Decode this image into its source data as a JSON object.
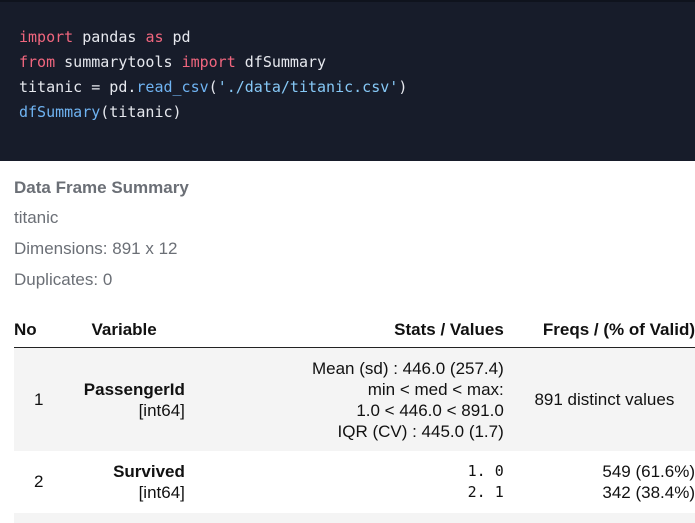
{
  "code": {
    "line1": {
      "kw1": "import",
      "mod": " pandas ",
      "kw2": "as",
      "alias": " pd"
    },
    "line2": {
      "kw1": "from",
      "mod": " summarytools ",
      "kw2": "import",
      "name": " dfSummary"
    },
    "line3": {
      "lhs": "titanic = pd.",
      "fn": "read_csv",
      "p1": "(",
      "str": "'./data/titanic.csv'",
      "p2": ")"
    },
    "line4": {
      "fn": "dfSummary",
      "args": "(titanic)"
    }
  },
  "summary": {
    "title": "Data Frame Summary",
    "name": "titanic",
    "dimensions": "Dimensions: 891 x 12",
    "duplicates": "Duplicates: 0"
  },
  "table": {
    "headers": {
      "no": "No",
      "variable": "Variable",
      "stats": "Stats / Values",
      "freqs": "Freqs / (% of Valid)"
    },
    "rows": [
      {
        "no": "1",
        "name": "PassengerId",
        "type": "[int64]",
        "stats": [
          "Mean (sd) : 446.0 (257.4)",
          "min < med < max:",
          "1.0 < 446.0 < 891.0",
          "IQR (CV) : 445.0 (1.7)"
        ],
        "freqs": [
          "891 distinct values"
        ]
      },
      {
        "no": "2",
        "name": "Survived",
        "type": "[int64]",
        "stats": [
          "1. 0",
          "2. 1"
        ],
        "freqs": [
          "549 (61.6%)",
          "342 (38.4%)"
        ]
      }
    ]
  }
}
